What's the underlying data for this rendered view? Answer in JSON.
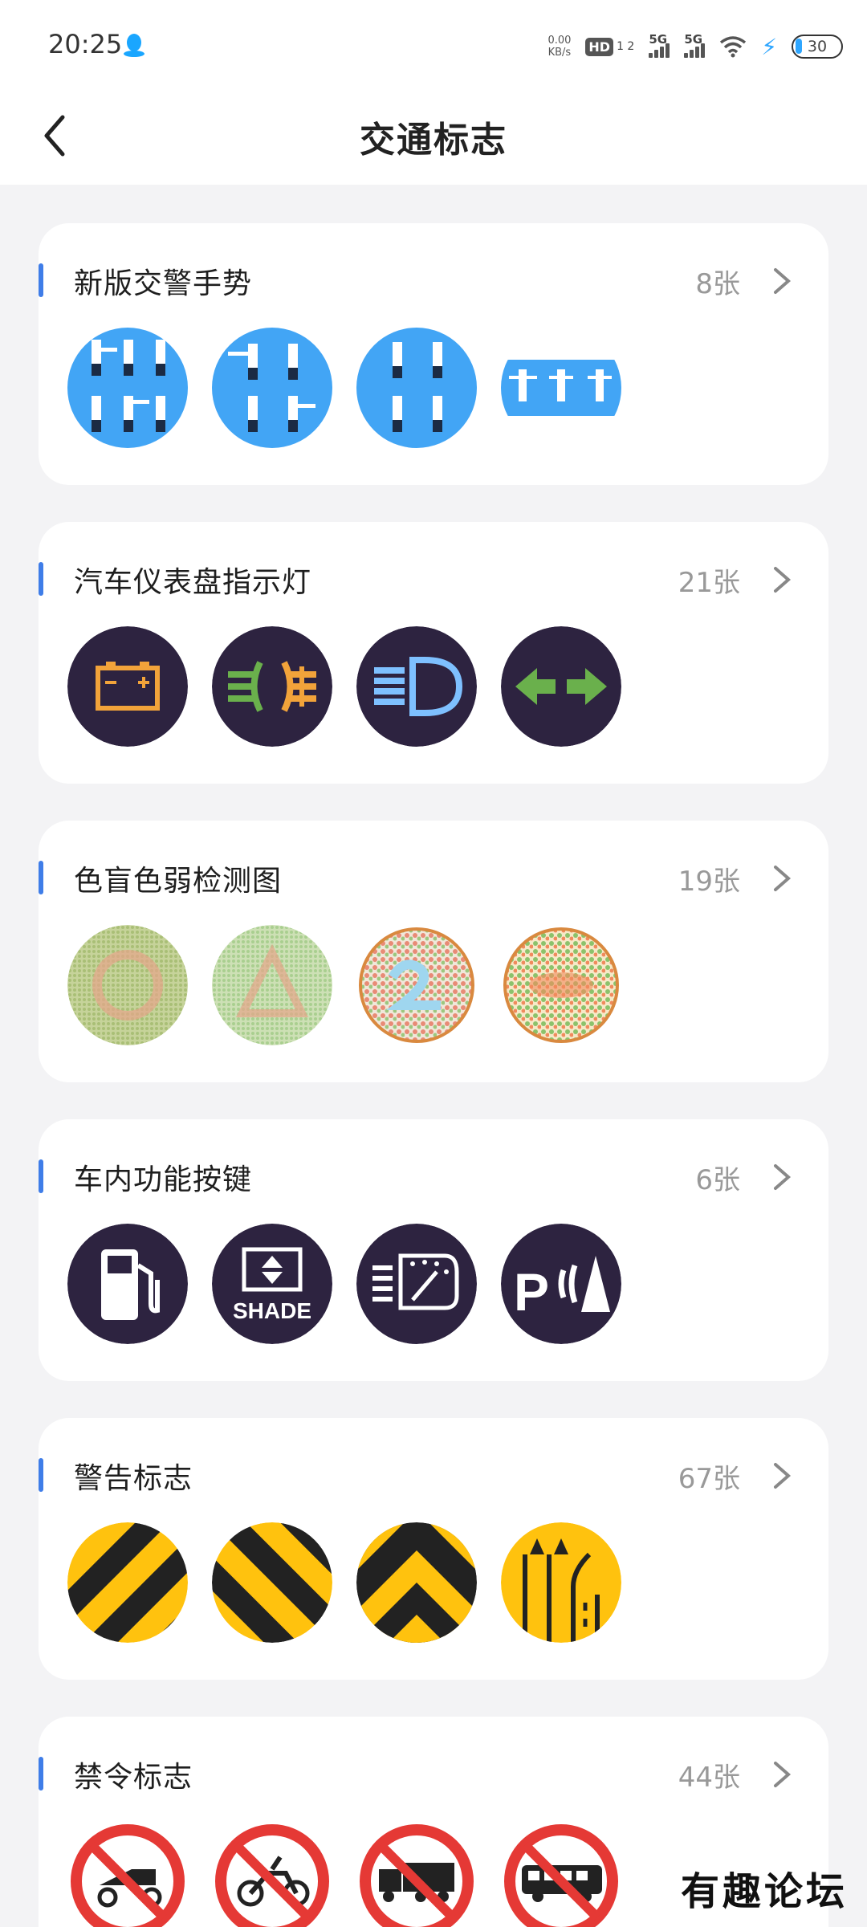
{
  "status_bar": {
    "time": "20:25",
    "net_speed": "0.00",
    "net_unit": "KB/s",
    "hd_label": "HD",
    "hd_sub": "1 2",
    "signal1": "5G",
    "signal2": "5G",
    "battery": "30"
  },
  "header": {
    "title": "交通标志"
  },
  "categories": [
    {
      "title": "新版交警手势",
      "count": "8张",
      "thumbs": [
        "police-gesture-1",
        "police-gesture-2",
        "police-gesture-3",
        "police-gesture-4"
      ]
    },
    {
      "title": "汽车仪表盘指示灯",
      "count": "21张",
      "thumbs": [
        "battery-light-icon",
        "fog-light-icon",
        "high-beam-icon",
        "turn-signal-icon"
      ]
    },
    {
      "title": "色盲色弱检测图",
      "count": "19张",
      "thumbs": [
        "color-test-circle",
        "color-test-triangle",
        "color-test-number",
        "color-test-dots"
      ]
    },
    {
      "title": "车内功能按键",
      "count": "6张",
      "thumbs": [
        "fuel-icon",
        "shade-icon",
        "rear-wiper-icon",
        "park-assist-icon"
      ]
    },
    {
      "title": "警告标志",
      "count": "67张",
      "thumbs": [
        "hazard-stripes-left",
        "hazard-stripes-right",
        "chevron-up-sign",
        "lane-sign"
      ]
    },
    {
      "title": "禁令标志",
      "count": "44张",
      "thumbs": [
        "no-tricycle-sign",
        "no-motorcycle-sign",
        "no-truck-sign",
        "no-bus-sign"
      ]
    }
  ],
  "thumb_labels": {
    "shade": "SHADE",
    "park": "P"
  },
  "watermark": "有趣论坛",
  "colors": {
    "accent": "#3f7de8",
    "dash_bg": "#2d2340",
    "sky": "#42a5f5",
    "warning_yellow": "#ffc20e"
  }
}
